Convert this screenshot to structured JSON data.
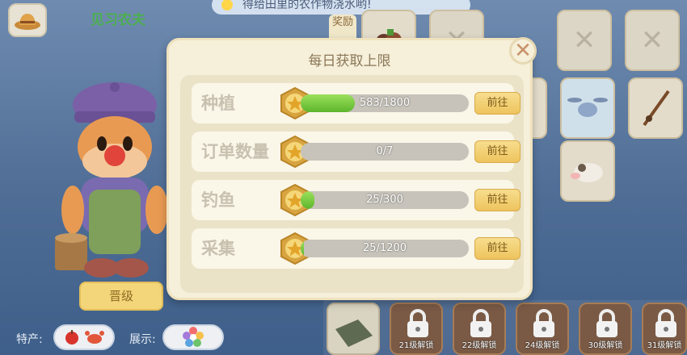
{
  "header": {
    "title": "见习农夫",
    "hint": "得给田里的农作物浇水哟!"
  },
  "side_tab": {
    "label": "奖励"
  },
  "left": {
    "upgrade_label": "晋级",
    "specialty_label": "特产:",
    "display_label": "展示:"
  },
  "modal": {
    "title": "每日获取上限",
    "close_symbol": "✕",
    "rows": [
      {
        "label": "种植",
        "current": 583,
        "max": 1800,
        "progress_text": "583/1800",
        "button": "前往"
      },
      {
        "label": "订单数量",
        "current": 0,
        "max": 7,
        "progress_text": "0/7",
        "button": "前往"
      },
      {
        "label": "钓鱼",
        "current": 25,
        "max": 300,
        "progress_text": "25/300",
        "button": "前往"
      },
      {
        "label": "采集",
        "current": 25,
        "max": 1200,
        "progress_text": "25/1200",
        "button": "前往"
      }
    ]
  },
  "unlock_slots": [
    {
      "label": "21级解锁"
    },
    {
      "label": "22级解锁"
    },
    {
      "label": "24级解锁"
    },
    {
      "label": "30级解锁"
    },
    {
      "label": "31级解锁"
    }
  ],
  "colors": {
    "progress_fill": "#7cc947",
    "modal_bg": "#f6efd9",
    "button_gold": "#eec35d"
  }
}
